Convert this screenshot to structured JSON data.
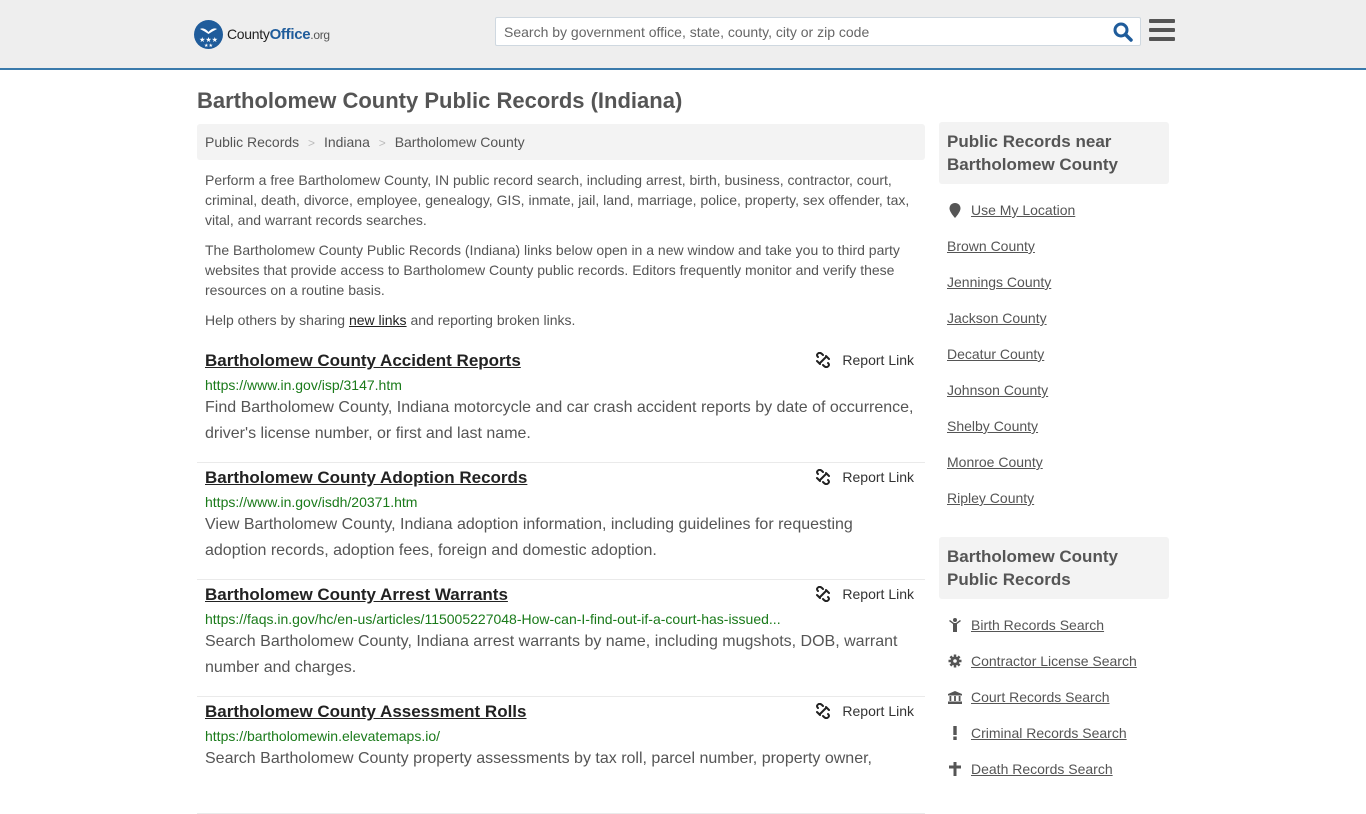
{
  "header": {
    "logo": {
      "prefix": "County",
      "office": "Office",
      "suffix": ".org",
      "badge": "★★★"
    },
    "search_placeholder": "Search by government office, state, county, city or zip code",
    "search_value": ""
  },
  "page_title": "Bartholomew County Public Records (Indiana)",
  "breadcrumb": [
    {
      "label": "Public Records"
    },
    {
      "label": "Indiana"
    },
    {
      "label": "Bartholomew County"
    }
  ],
  "breadcrumb_separator": ">",
  "intro": {
    "p1": "Perform a free Bartholomew County, IN public record search, including arrest, birth, business, contractor, court, criminal, death, divorce, employee, genealogy, GIS, inmate, jail, land, marriage, police, property, sex offender, tax, vital, and warrant records searches.",
    "p2": "The Bartholomew County Public Records (Indiana) links below open in a new window and take you to third party websites that provide access to Bartholomew County public records. Editors frequently monitor and verify these resources on a routine basis.",
    "p3_before": "Help others by sharing ",
    "p3_link": "new links",
    "p3_after": " and reporting broken links."
  },
  "report_label": "Report Link",
  "records": [
    {
      "title": "Bartholomew County Accident Reports",
      "url": "https://www.in.gov/isp/3147.htm",
      "desc": "Find Bartholomew County, Indiana motorcycle and car crash accident reports by date of occurrence, driver's license number, or first and last name."
    },
    {
      "title": "Bartholomew County Adoption Records",
      "url": "https://www.in.gov/isdh/20371.htm",
      "desc": "View Bartholomew County, Indiana adoption information, including guidelines for requesting adoption records, adoption fees, foreign and domestic adoption."
    },
    {
      "title": "Bartholomew County Arrest Warrants",
      "url": "https://faqs.in.gov/hc/en-us/articles/115005227048-How-can-I-find-out-if-a-court-has-issued...",
      "desc": "Search Bartholomew County, Indiana arrest warrants by name, including mugshots, DOB, warrant number and charges."
    },
    {
      "title": "Bartholomew County Assessment Rolls",
      "url": "https://bartholomewin.elevatemaps.io/",
      "desc": "Search Bartholomew County property assessments by tax roll, parcel number, property owner,"
    }
  ],
  "sidebar": {
    "nearby": {
      "heading": "Public Records near Bartholomew County",
      "use_location": "Use My Location",
      "items": [
        "Brown County",
        "Jennings County",
        "Jackson County",
        "Decatur County",
        "Johnson County",
        "Shelby County",
        "Monroe County",
        "Ripley County"
      ]
    },
    "county_records": {
      "heading": "Bartholomew County Public Records",
      "items": [
        {
          "label": "Birth Records Search",
          "icon": "child-icon"
        },
        {
          "label": "Contractor License Search",
          "icon": "gear-icon"
        },
        {
          "label": "Court Records Search",
          "icon": "courthouse-icon"
        },
        {
          "label": "Criminal Records Search",
          "icon": "exclamation-icon"
        },
        {
          "label": "Death Records Search",
          "icon": "cross-icon"
        }
      ]
    }
  },
  "colors": {
    "header_bg": "#eeeeee",
    "header_border": "#3a7aab",
    "brand_blue": "#1f5c9b",
    "url_green": "#1a7a1a",
    "panel_bg": "#f3f3f3"
  }
}
